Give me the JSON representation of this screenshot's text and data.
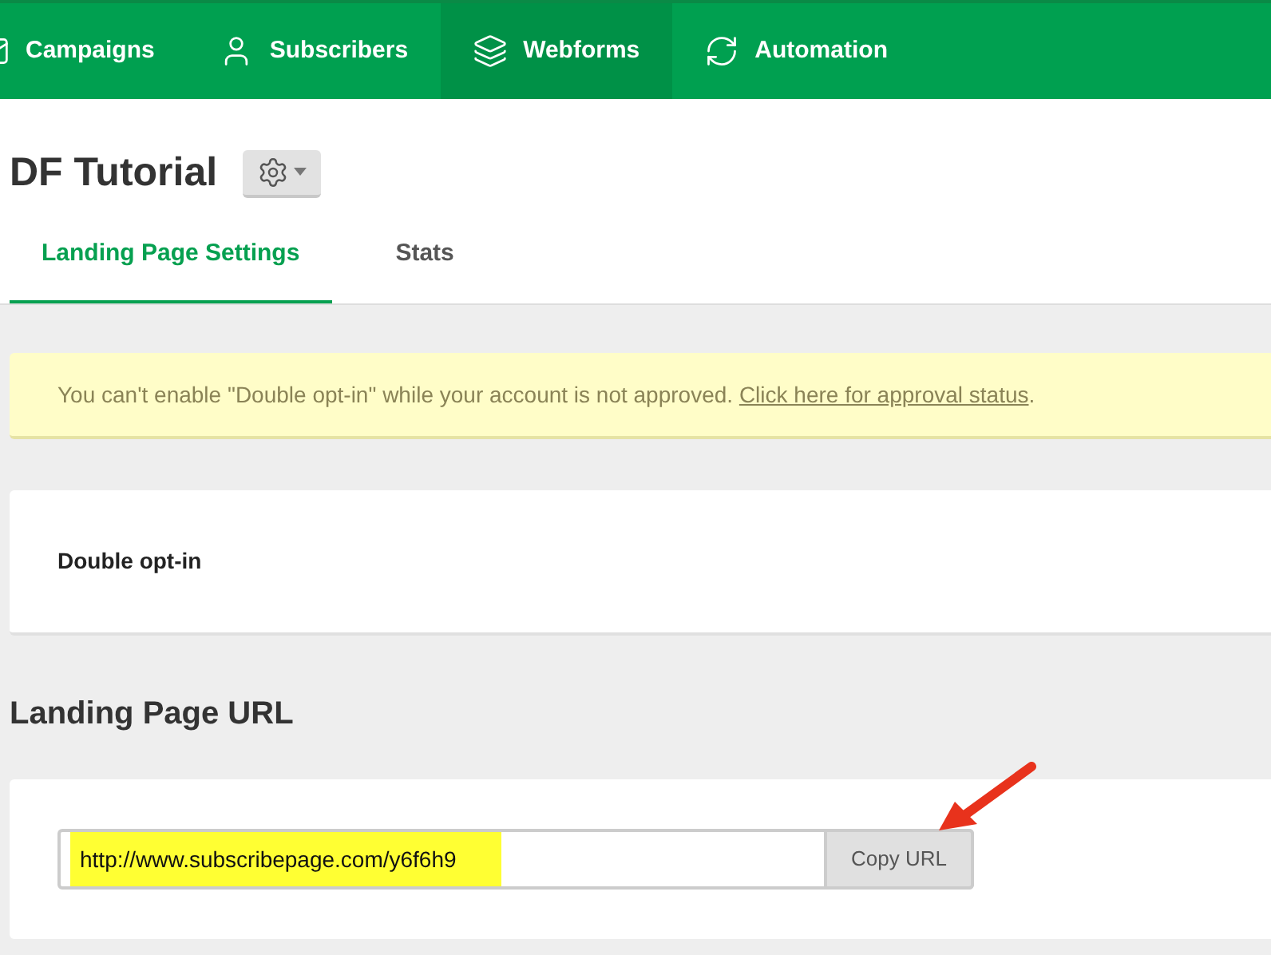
{
  "nav": [
    {
      "label": "Campaigns",
      "kind": "campaign",
      "selected": false
    },
    {
      "label": "Subscribers",
      "kind": "user",
      "selected": false
    },
    {
      "label": "Webforms",
      "kind": "layers",
      "selected": true
    },
    {
      "label": "Automation",
      "kind": "refresh",
      "selected": false
    }
  ],
  "title": "DF Tutorial",
  "tabs": [
    {
      "label": "Landing Page Settings",
      "selected": true
    },
    {
      "label": "Stats",
      "selected": false
    }
  ],
  "notice": {
    "text": "You can't enable \"Double opt-in\" while your account is not approved.",
    "link": "Click here for approval status",
    "after": "."
  },
  "double_optin": {
    "label": "Double opt-in"
  },
  "url_section": {
    "heading": "Landing Page URL",
    "url": "http://www.subscribepage.com/y6f6h9",
    "button": "Copy URL"
  }
}
